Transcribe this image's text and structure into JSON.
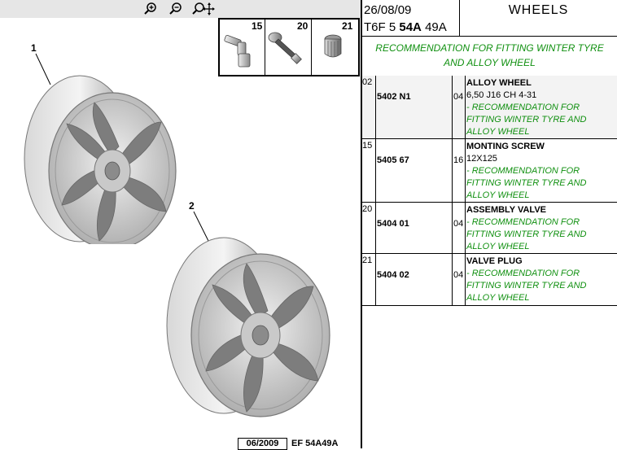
{
  "toolbar": {
    "zoom_in_icon": "zoom-in-icon",
    "zoom_out_icon": "zoom-out-icon",
    "zoom_pan_icon": "zoom-pan-icon"
  },
  "diagram": {
    "callouts": [
      "1",
      "2"
    ],
    "accessories": [
      {
        "num": "15",
        "icon": "bolt-icon"
      },
      {
        "num": "20",
        "icon": "valve-icon"
      },
      {
        "num": "21",
        "icon": "valve-cap-icon"
      }
    ],
    "footer_date": "06/2009",
    "footer_ref": "EF 54A49A"
  },
  "header": {
    "date": "26/08/09",
    "code_prefix": "T6F 5",
    "code_bold": "54A",
    "code_suffix": "49A",
    "title": "WHEELS"
  },
  "recommendation": {
    "line1": "RECOMMENDATION FOR FITTING WINTER TYRE",
    "line2": "AND ALLOY WHEEL"
  },
  "parts": [
    {
      "ref": "02",
      "number": "5402 N1",
      "qty": "04",
      "name": "ALLOY WHEEL",
      "detail": "6,50 J16 CH 4-31",
      "notes": [
        "- RECOMMENDATION FOR",
        "FITTING WINTER TYRE AND",
        "ALLOY WHEEL"
      ]
    },
    {
      "ref": "15",
      "number": "5405 67",
      "qty": "16",
      "name": "MONTING SCREW",
      "detail": "12X125",
      "notes": [
        "- RECOMMENDATION FOR",
        "FITTING WINTER TYRE AND",
        "ALLOY WHEEL"
      ]
    },
    {
      "ref": "20",
      "number": "5404 01",
      "qty": "04",
      "name": "ASSEMBLY VALVE",
      "detail": "",
      "notes": [
        "- RECOMMENDATION FOR",
        "FITTING WINTER TYRE AND",
        "ALLOY WHEEL"
      ]
    },
    {
      "ref": "21",
      "number": "5404 02",
      "qty": "04",
      "name": "VALVE PLUG",
      "detail": "",
      "notes": [
        "- RECOMMENDATION FOR",
        "FITTING WINTER TYRE AND",
        "ALLOY WHEEL"
      ]
    }
  ]
}
